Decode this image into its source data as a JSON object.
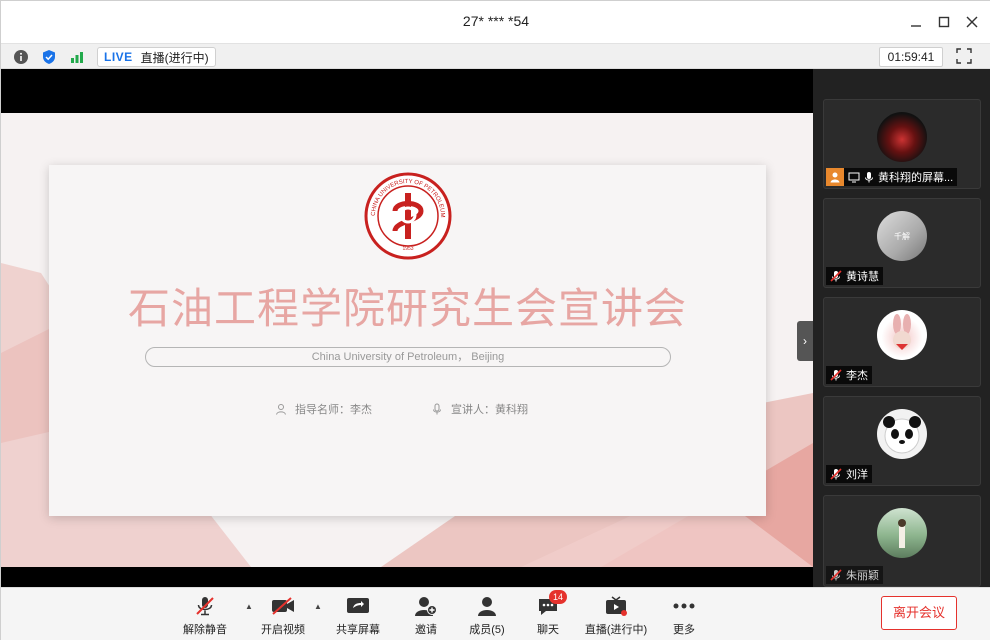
{
  "window": {
    "title": "27* *** *54"
  },
  "statusbar": {
    "live_label": "LIVE",
    "live_status": "直播(进行中)",
    "timer": "01:59:41",
    "icons": [
      "info-icon",
      "shield-icon",
      "signal-icon",
      "fullscreen-icon"
    ]
  },
  "slide": {
    "title": "石油工程学院研究生会宣讲会",
    "subtitle": "China University of Petroleum， Beijing",
    "advisor": "指导名师：李杰",
    "speaker": "宣讲人：黄科翔",
    "logo_text": "CHINA UNIVERSITY OF PETROLEUM",
    "logo_year": "1953"
  },
  "participants": [
    {
      "name": "黄科翔的屏幕...",
      "avatar_text": ""
    },
    {
      "name": "黄诗慧",
      "avatar_text": "千解"
    },
    {
      "name": "李杰",
      "avatar_text": ""
    },
    {
      "name": "刘洋",
      "avatar_text": ""
    },
    {
      "name": "朱丽颖",
      "avatar_text": ""
    }
  ],
  "toolbar": {
    "unmute": "解除静音",
    "start_video": "开启视频",
    "share_screen": "共享屏幕",
    "invite": "邀请",
    "members": "成员(5)",
    "chat": "聊天",
    "chat_badge": "14",
    "live": "直播(进行中)",
    "more": "更多",
    "leave": "离开会议"
  },
  "colors": {
    "accent_red": "#e5322d",
    "live_blue": "#1a73e8",
    "slide_title": "#e7a6a3"
  }
}
